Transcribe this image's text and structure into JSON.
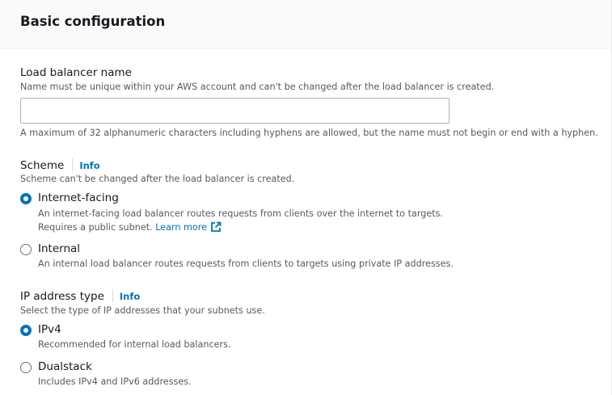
{
  "panel": {
    "title": "Basic configuration"
  },
  "lb_name": {
    "label": "Load balancer name",
    "description": "Name must be unique within your AWS account and can't be changed after the load balancer is created.",
    "value": "",
    "constraint": "A maximum of 32 alphanumeric characters including hyphens are allowed, but the name must not begin or end with a hyphen."
  },
  "scheme": {
    "label": "Scheme",
    "info": "Info",
    "description": "Scheme can't be changed after the load balancer is created.",
    "options": [
      {
        "label": "Internet-facing",
        "selected": true,
        "description": "An internet-facing load balancer routes requests from clients over the internet to targets.",
        "description2": "Requires a public subnet.",
        "link": "Learn more"
      },
      {
        "label": "Internal",
        "selected": false,
        "description": "An internal load balancer routes requests from clients to targets using private IP addresses."
      }
    ]
  },
  "ip_type": {
    "label": "IP address type",
    "info": "Info",
    "description": "Select the type of IP addresses that your subnets use.",
    "options": [
      {
        "label": "IPv4",
        "selected": true,
        "description": "Recommended for internal load balancers."
      },
      {
        "label": "Dualstack",
        "selected": false,
        "description": "Includes IPv4 and IPv6 addresses."
      }
    ]
  },
  "colors": {
    "accent": "#0073bb",
    "text": "#16191f",
    "muted": "#545b64",
    "header_bg": "#fafafa"
  },
  "icons": {
    "external_link": "external-link-icon"
  }
}
